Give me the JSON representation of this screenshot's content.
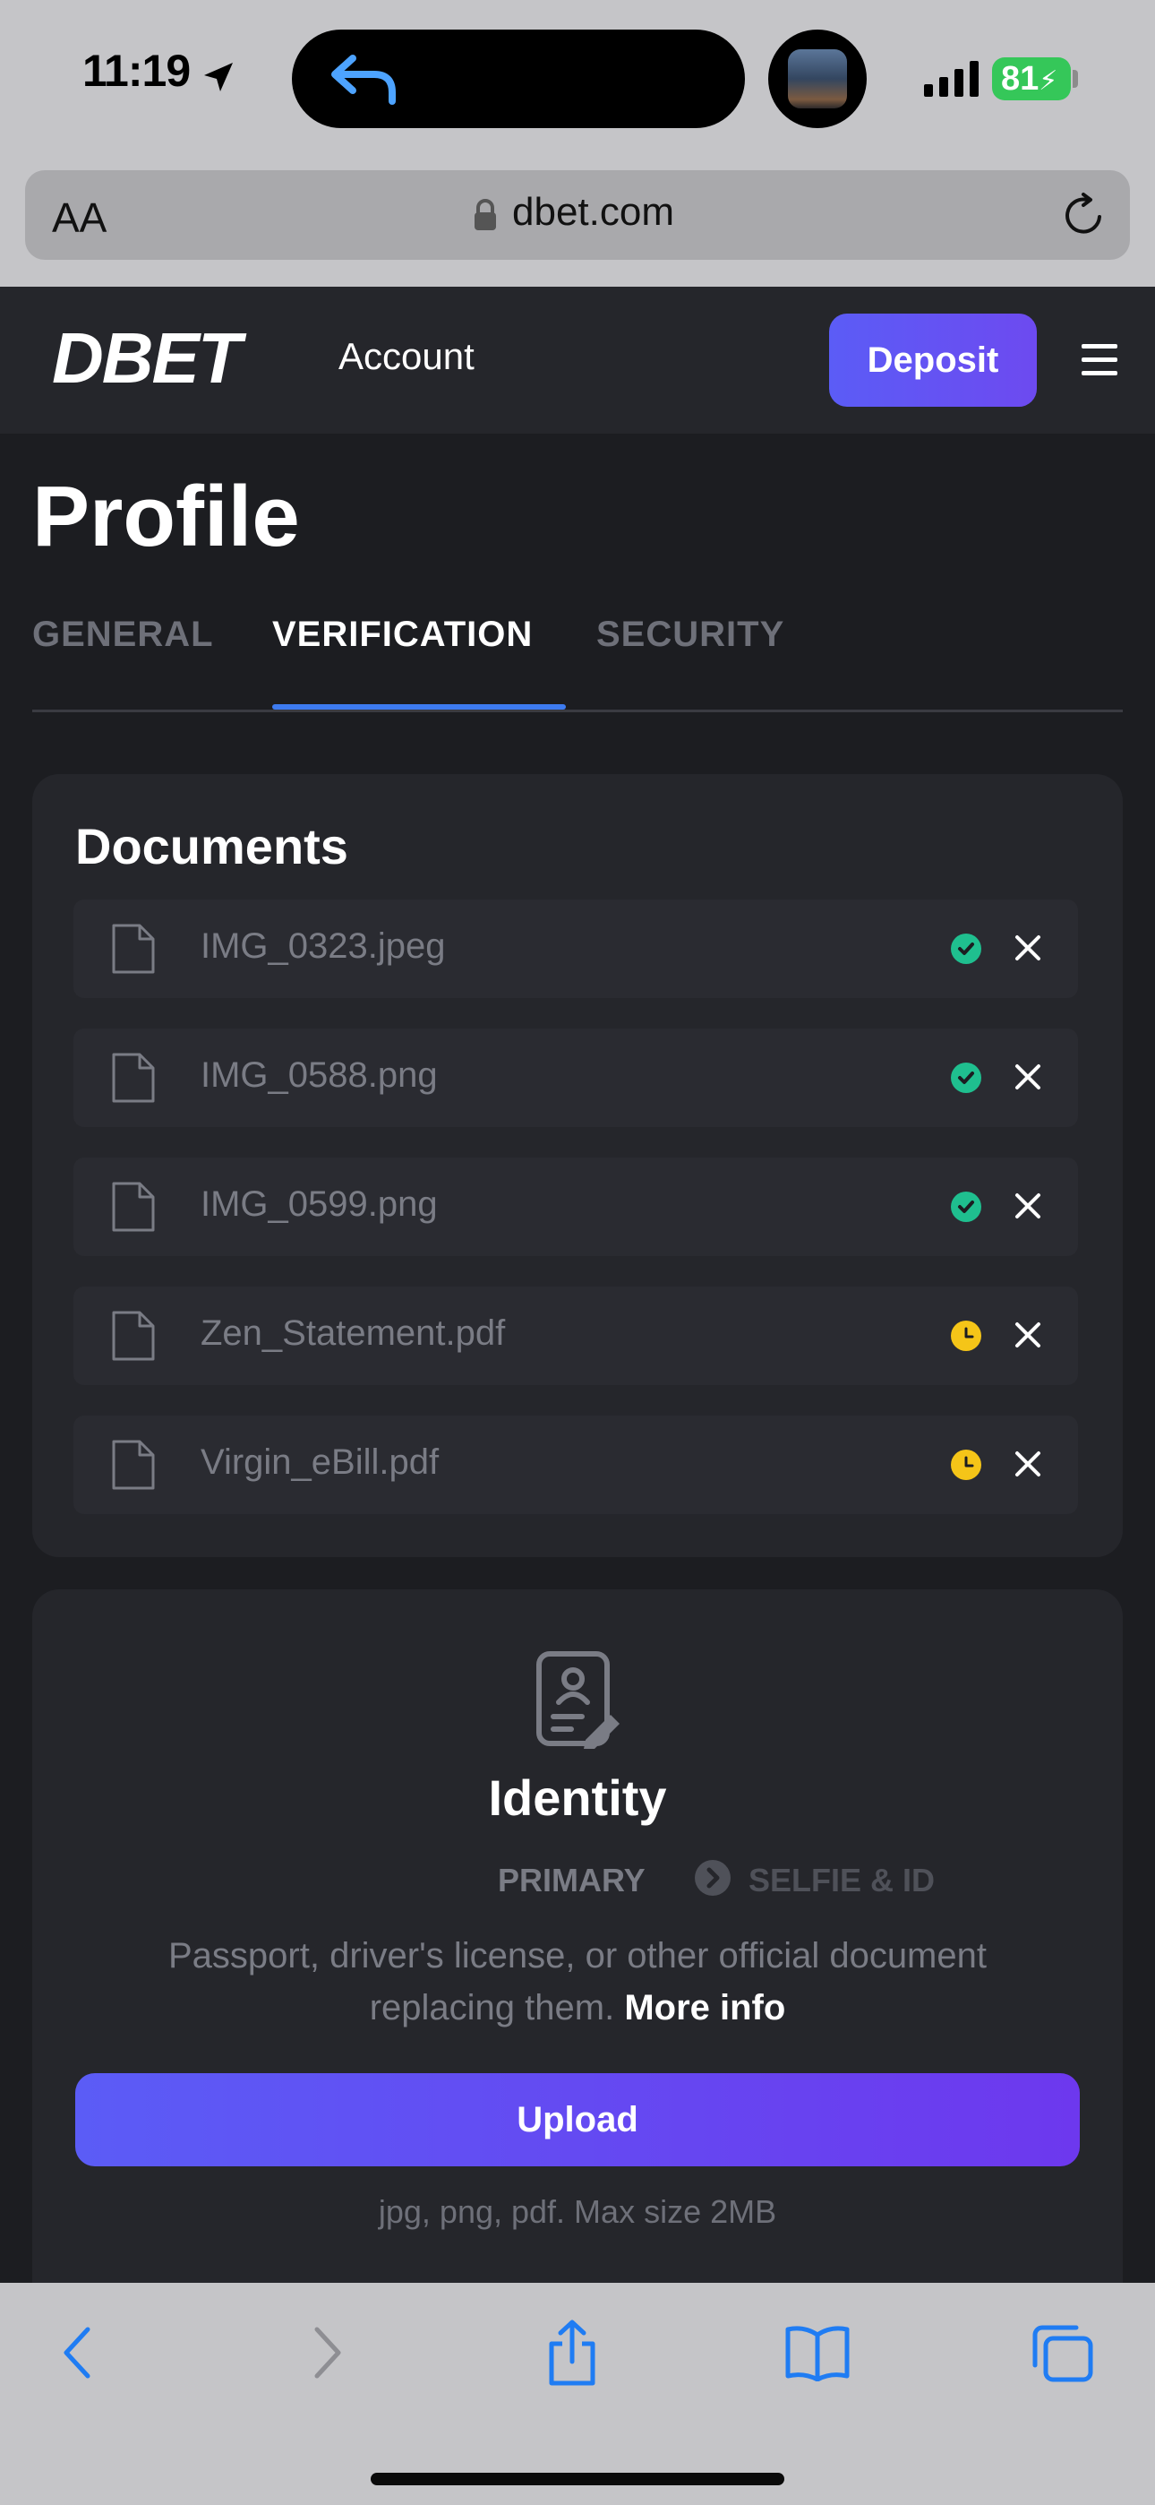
{
  "status_bar": {
    "time": "11:19",
    "battery": "81"
  },
  "browser": {
    "text_size_label": "AA",
    "url": "dbet.com"
  },
  "header": {
    "logo": "DBET",
    "nav_label": "Account",
    "deposit_label": "Deposit"
  },
  "page": {
    "title": "Profile",
    "tabs": [
      {
        "label": "GENERAL",
        "active": false
      },
      {
        "label": "VERIFICATION",
        "active": true
      },
      {
        "label": "SECURITY",
        "active": false
      }
    ]
  },
  "documents": {
    "title": "Documents",
    "files": [
      {
        "name": "IMG_0323.jpeg",
        "status": "approved"
      },
      {
        "name": "IMG_0588.png",
        "status": "approved"
      },
      {
        "name": "IMG_0599.png",
        "status": "approved"
      },
      {
        "name": "Zen_Statement.pdf",
        "status": "pending"
      },
      {
        "name": "Virgin_eBill.pdf",
        "status": "pending"
      }
    ]
  },
  "identity": {
    "title": "Identity",
    "step_primary": "PRIMARY",
    "step_secondary": "SELFIE & ID",
    "description": "Passport, driver's license, or other official document replacing them.",
    "more_info_label": "More info",
    "upload_label": "Upload",
    "upload_hint": "jpg, png, pdf. Max size 2MB"
  },
  "colors": {
    "accent": "#5b5cf6",
    "approved": "#1fbf8f",
    "pending": "#f5c518",
    "tab_underline": "#3d7bf0"
  }
}
